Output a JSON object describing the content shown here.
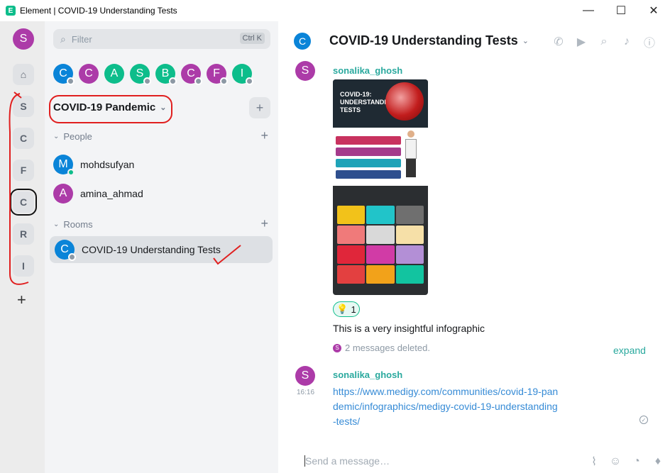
{
  "window": {
    "title": "Element | COVID-19 Understanding Tests",
    "logo_letter": "E",
    "minimize": "—",
    "maximize": "☐",
    "close": "✕"
  },
  "spaces": {
    "user_initial": "S",
    "home": "⌂",
    "tiles": [
      "S",
      "C",
      "F",
      "C",
      "R",
      "I"
    ],
    "selected_index": 3,
    "add": "+"
  },
  "roomlist": {
    "filter_placeholder": "Filter",
    "filter_shortcut": "Ctrl K",
    "recent_avatars": [
      {
        "letter": "C",
        "color": "#0a84d8"
      },
      {
        "letter": "C",
        "color": "#ac3ba8"
      },
      {
        "letter": "A",
        "color": "#0dbd8b"
      },
      {
        "letter": "S",
        "color": "#0dbd8b"
      },
      {
        "letter": "B",
        "color": "#0dbd8b"
      },
      {
        "letter": "C",
        "color": "#ac3ba8"
      },
      {
        "letter": "F",
        "color": "#ac3ba8"
      },
      {
        "letter": "I",
        "color": "#0dbd8b"
      }
    ],
    "space_name": "COVID-19 Pandemic",
    "space_add": "+",
    "people_label": "People",
    "people_add": "+",
    "people": [
      {
        "name": "mohdsufyan",
        "initial": "M",
        "color": "#0a84d8",
        "online": true
      },
      {
        "name": "amina_ahmad",
        "initial": "A",
        "color": "#ac3ba8",
        "online": false
      }
    ],
    "rooms_label": "Rooms",
    "rooms_add": "+",
    "rooms": [
      {
        "name": "COVID-19 Understanding Tests",
        "initial": "C",
        "color": "#0a84d8"
      }
    ]
  },
  "room_header": {
    "initial": "C",
    "title": "COVID-19 Understanding Tests",
    "icons": [
      "phone-icon",
      "video-icon",
      "search-icon",
      "bell-icon",
      "info-icon"
    ]
  },
  "timeline": {
    "messages": [
      {
        "sender": "sonalika_ghosh",
        "initial": "S",
        "image_title": "COVID-19: UNDERSTANDING TESTS",
        "reaction_emoji": "💡",
        "reaction_count": "1",
        "text": "This is a very insightful infographic"
      },
      {
        "sender": "sonalika_ghosh",
        "initial": "S",
        "timestamp": "16:16",
        "link": "https://www.medigy.com/communities/covid-19-pandemic/infographics/medigy-covid-19-understanding-tests/"
      }
    ],
    "deleted_initial": "S",
    "deleted_text": "2 messages deleted.",
    "expand_label": "expand"
  },
  "composer": {
    "placeholder": "Send a message…",
    "icons": [
      "attachment-icon",
      "emoji-icon",
      "sticker-icon",
      "microphone-icon"
    ]
  }
}
